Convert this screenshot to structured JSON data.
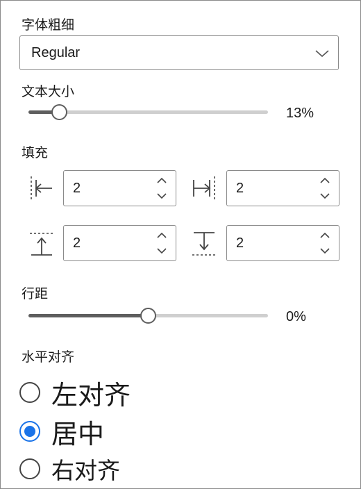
{
  "font_weight": {
    "title": "字体粗细",
    "selected": "Regular"
  },
  "text_size": {
    "title": "文本大小",
    "value_label": "13%",
    "value": 0.13
  },
  "padding": {
    "title": "填充",
    "left": "2",
    "right": "2",
    "top": "2",
    "bottom": "2"
  },
  "line_spacing": {
    "title": "行距",
    "value_label": "0%",
    "position": 0.5
  },
  "horizontal_align": {
    "title": "水平对齐",
    "options": [
      {
        "label": "左对齐",
        "checked": false
      },
      {
        "label": "居中",
        "checked": true
      },
      {
        "label": "右对齐",
        "checked": false
      }
    ]
  },
  "colors": {
    "accent": "#1a73e8",
    "slider_fill": "#5e5e5e",
    "slider_track": "#cfcfcf",
    "border": "#8a8a8a"
  },
  "icons": {
    "dropdown": "chevron-down-icon",
    "pad_left": "padding-left-icon",
    "pad_right": "padding-right-icon",
    "pad_top": "padding-top-icon",
    "pad_bottom": "padding-bottom-icon",
    "spin_up": "chevron-up-icon",
    "spin_down": "chevron-down-icon"
  }
}
